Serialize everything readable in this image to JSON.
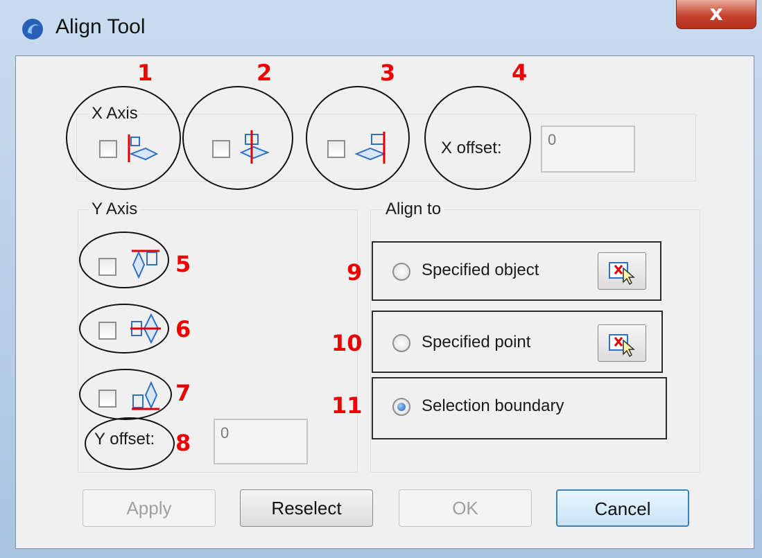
{
  "window": {
    "title": "Align Tool",
    "close_glyph": "x",
    "app_icon": "app-logo-icon"
  },
  "x_axis": {
    "label": "X Axis",
    "offset_label": "X offset:",
    "offset_value": "0",
    "annotations": [
      "1",
      "2",
      "3",
      "4"
    ]
  },
  "y_axis": {
    "label": "Y Axis",
    "offset_label": "Y offset:",
    "offset_value": "0",
    "annotations": [
      "5",
      "6",
      "7",
      "8"
    ]
  },
  "align_to": {
    "label": "Align to",
    "options": [
      {
        "label": "Specified object",
        "annotation": "9",
        "selected": false
      },
      {
        "label": "Specified point",
        "annotation": "10",
        "selected": false
      },
      {
        "label": "Selection boundary",
        "annotation": "11",
        "selected": true
      }
    ]
  },
  "buttons": {
    "apply": "Apply",
    "reselect": "Reselect",
    "ok": "OK",
    "cancel": "Cancel"
  },
  "colors": {
    "annotation": "#ee0000",
    "accent": "#3c7fb1",
    "close": "#c7432f",
    "guide_line": "#e00000",
    "shape": "#2f6fc4"
  }
}
